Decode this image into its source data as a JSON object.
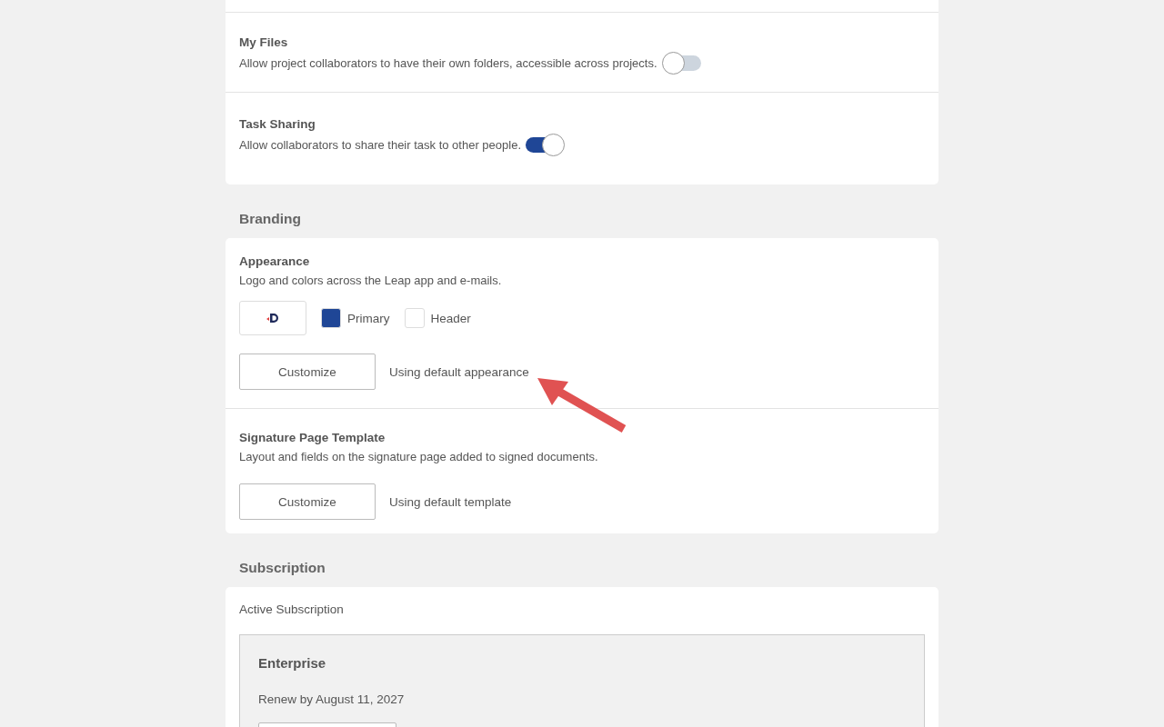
{
  "collaboration": {
    "settings": [
      {
        "title": "My Files",
        "description": "Allow project collaborators to have their own folders, accessible across projects.",
        "on": false
      },
      {
        "title": "Task Sharing",
        "description": "Allow collaborators to share their task to other people.",
        "on": true
      }
    ]
  },
  "branding": {
    "heading": "Branding",
    "appearance": {
      "title": "Appearance",
      "description": "Logo and colors across the Leap app and e-mails.",
      "colors": [
        {
          "label": "Primary",
          "color": "#1f4696"
        },
        {
          "label": "Header",
          "color": "#ffffff"
        }
      ],
      "button": "Customize",
      "status": "Using default appearance"
    },
    "signature": {
      "title": "Signature Page Template",
      "description": "Layout and fields on the signature page added to signed documents.",
      "button": "Customize",
      "status": "Using default template"
    }
  },
  "subscription": {
    "heading": "Subscription",
    "label": "Active Subscription",
    "plan": {
      "name": "Enterprise",
      "renewal": "Renew by August 11, 2027"
    }
  }
}
